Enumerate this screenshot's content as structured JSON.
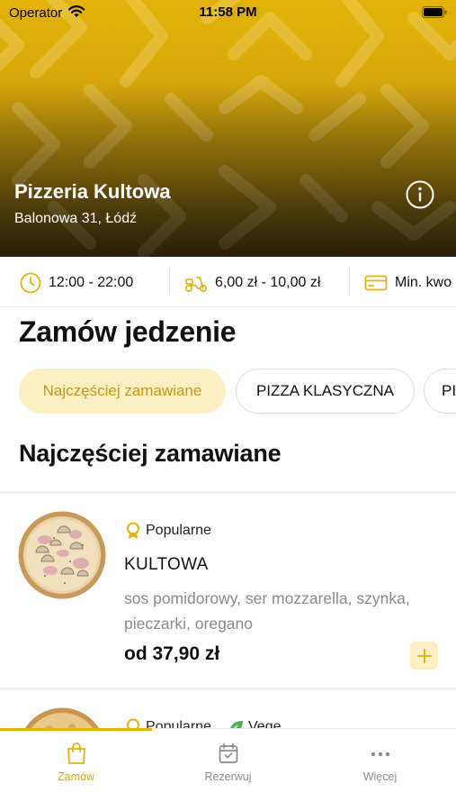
{
  "status_bar": {
    "carrier": "Operator",
    "time": "11:58 PM"
  },
  "restaurant": {
    "name": "Pizzeria Kultowa",
    "address": "Balonowa 31, Łódź"
  },
  "info_strip": {
    "hours": "12:00 - 22:00",
    "delivery_cost": "6,00 zł - 10,00 zł",
    "min_order": "Min. kwo"
  },
  "section_title": "Zamów jedzenie",
  "categories": [
    {
      "label": "Najczęściej zamawiane",
      "active": true
    },
    {
      "label": "PIZZA KLASYCZNA",
      "active": false
    },
    {
      "label": "PI",
      "active": false
    }
  ],
  "subsection_title": "Najczęściej zamawiane",
  "products": [
    {
      "tags": [
        {
          "label": "Popularne",
          "icon": "medal-icon"
        }
      ],
      "name": "KULTOWA",
      "description": "sos pomidorowy, ser mozzarella, szynka, pieczarki, oregano",
      "price": "od 37,90 zł"
    },
    {
      "tags": [
        {
          "label": "Popularne",
          "icon": "medal-icon"
        },
        {
          "label": "Vege",
          "icon": "leaf-icon"
        }
      ]
    }
  ],
  "tabbar": {
    "tabs": [
      {
        "label": "Zamów",
        "icon": "shopping-bag-icon",
        "active": true
      },
      {
        "label": "Rezerwuj",
        "icon": "calendar-icon",
        "active": false
      },
      {
        "label": "Więcej",
        "icon": "more-dots-icon",
        "active": false
      }
    ]
  },
  "colors": {
    "accent": "#e5b20c",
    "accent_light": "#fbefc3",
    "vege_green": "#4caf50"
  }
}
